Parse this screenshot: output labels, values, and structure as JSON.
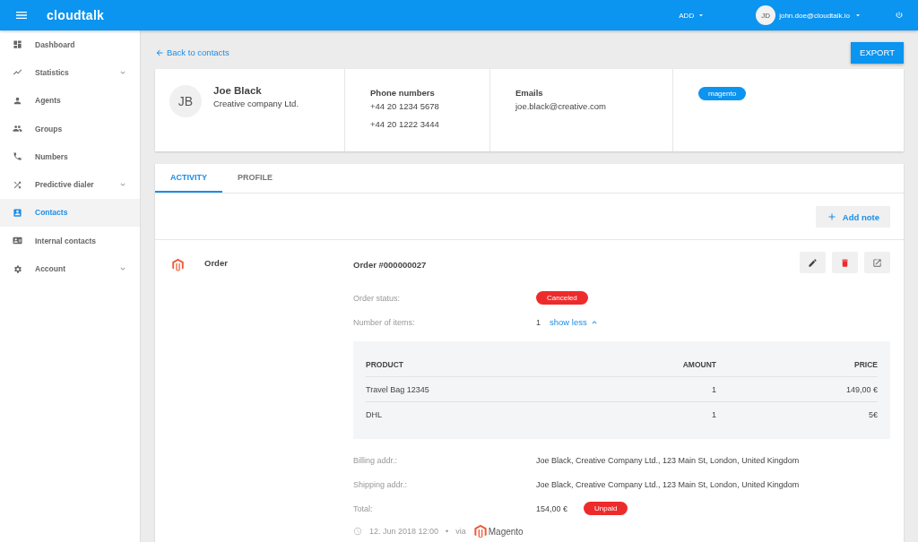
{
  "header": {
    "logo": "cloudtalk",
    "add_menu": "ADD",
    "avatar": "JD",
    "user": "john.doe@cloudtalk.io"
  },
  "sidebar": {
    "items": [
      {
        "label": "Dashboard",
        "expandable": false,
        "selected": false
      },
      {
        "label": "Statistics",
        "expandable": true,
        "selected": false
      },
      {
        "label": "Agents",
        "expandable": false,
        "selected": false
      },
      {
        "label": "Groups",
        "expandable": false,
        "selected": false
      },
      {
        "label": "Numbers",
        "expandable": false,
        "selected": false
      },
      {
        "label": "Predictive dialer",
        "expandable": true,
        "selected": false
      },
      {
        "label": "Contacts",
        "expandable": false,
        "selected": true
      },
      {
        "label": "Internal contacts",
        "expandable": false,
        "selected": false
      },
      {
        "label": "Account",
        "expandable": true,
        "selected": false
      }
    ]
  },
  "back_link": "Back to contacts",
  "export_button": "EXPORT",
  "contact": {
    "initials": "JB",
    "name": "Joe Black",
    "company": "Creative company Ltd.",
    "phone_heading": "Phone numbers",
    "phones": [
      "+44 20 1234 5678",
      "+44 20 1222 3444"
    ],
    "email_heading": "Emails",
    "emails": [
      "joe.black@creative.com"
    ],
    "tags": [
      "magento"
    ]
  },
  "tabs": [
    {
      "label": "ACTIVITY",
      "selected": true
    },
    {
      "label": "PROFILE",
      "selected": false
    }
  ],
  "add_note_button": "Add note",
  "order": {
    "type_label": "Order",
    "title": "Order #000000027",
    "fields": [
      {
        "label": "Order status:",
        "kind": "badge",
        "value": "Canceled"
      },
      {
        "label": "Number of items:",
        "kind": "count",
        "value": "1",
        "link": "show less"
      }
    ],
    "table": {
      "columns": [
        "PRODUCT",
        "AMOUNT",
        "PRICE"
      ],
      "rows": [
        [
          "Travel Bag 12345",
          "1",
          "149,00 €"
        ],
        [
          "DHL",
          "1",
          "5€"
        ]
      ]
    },
    "details": [
      {
        "label": "Billing addr.:",
        "value": "Joe Black, Creative Company Ltd., 123 Main St, London, United Kingdom"
      },
      {
        "label": "Shipping addr.:",
        "value": "Joe Black, Creative Company Ltd., 123 Main St, London, United Kingdom"
      },
      {
        "label": "Total:",
        "value": "154,00 €",
        "badge": "Unpaid"
      }
    ],
    "date": "12. Jun 2018 12:00",
    "separator": "•",
    "via": "via",
    "source": "Magento"
  }
}
